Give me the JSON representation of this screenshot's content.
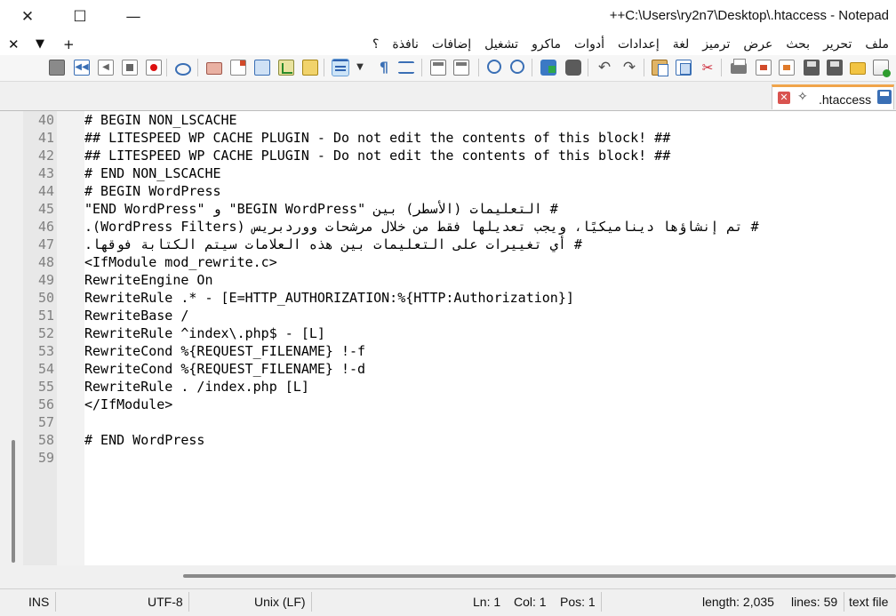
{
  "window": {
    "title": "++C:\\Users\\ry2n7\\Desktop\\.htaccess - Notepad",
    "close_glyph": "✕",
    "maximize_glyph": "☐",
    "minimize_glyph": "—"
  },
  "menubar": {
    "close_glyph": "✕",
    "dropdown_glyph": "▼",
    "add_glyph": "+",
    "items": [
      "ملف",
      "تحرير",
      "بحث",
      "عرض",
      "ترميز",
      "لغة",
      "إعدادات",
      "أدوات",
      "ماكرو",
      "تشغيل",
      "إضافات",
      "نافذة",
      "؟"
    ]
  },
  "tab": {
    "label": ".htaccess"
  },
  "editor": {
    "lines": [
      {
        "n": "40",
        "text": "# BEGIN NON_LSCACHE"
      },
      {
        "n": "41",
        "text": "## LITESPEED WP CACHE PLUGIN - Do not edit the contents of this block! ##"
      },
      {
        "n": "42",
        "text": "## LITESPEED WP CACHE PLUGIN - Do not edit the contents of this block! ##"
      },
      {
        "n": "43",
        "text": "# END NON_LSCACHE"
      },
      {
        "n": "44",
        "text": "# BEGIN WordPress"
      },
      {
        "n": "45",
        "text": "# التعليمات (الأسطر) بين \"BEGIN WordPress\" و \"END WordPress\""
      },
      {
        "n": "46",
        "text": "# تم إنشاؤها ديناميكيًا، ويجب تعديلها فقط من خلال مرشحات ووردبريس (WordPress Filters)."
      },
      {
        "n": "47",
        "text": "# أي تغييرات على التعليمات بين هذه العلامات سيتم الكتابة فوقها."
      },
      {
        "n": "48",
        "text": "<IfModule mod_rewrite.c>"
      },
      {
        "n": "49",
        "text": "RewriteEngine On"
      },
      {
        "n": "50",
        "text": "RewriteRule .* - [E=HTTP_AUTHORIZATION:%{HTTP:Authorization}]"
      },
      {
        "n": "51",
        "text": "RewriteBase /"
      },
      {
        "n": "52",
        "text": "RewriteRule ^index\\.php$ - [L]"
      },
      {
        "n": "53",
        "text": "RewriteCond %{REQUEST_FILENAME} !-f"
      },
      {
        "n": "54",
        "text": "RewriteCond %{REQUEST_FILENAME} !-d"
      },
      {
        "n": "55",
        "text": "RewriteRule . /index.php [L]"
      },
      {
        "n": "56",
        "text": "</IfModule>"
      },
      {
        "n": "57",
        "text": ""
      },
      {
        "n": "58",
        "text": "# END WordPress"
      },
      {
        "n": "59",
        "text": ""
      }
    ]
  },
  "statusbar": {
    "mode": "INS",
    "encoding": "UTF-8",
    "eol": "Unix (LF)",
    "ln": "Ln: 1",
    "col": "Col: 1",
    "pos": "Pos: 1",
    "length": "length: 2,035",
    "lines": "lines: 59",
    "type": "text file"
  },
  "colors": {
    "tab_accent": "#f0a44a",
    "selected_tool": "#cde4f7"
  },
  "icons": [
    "new-file-icon",
    "open-file-icon",
    "save-icon",
    "save-all-icon",
    "close-icon",
    "close-all-icon",
    "print-icon",
    "cut-icon",
    "copy-icon",
    "paste-icon",
    "undo-icon",
    "redo-icon",
    "find-icon",
    "replace-icon",
    "zoom-in-icon",
    "zoom-out-icon",
    "sync-icon",
    "wrap-icon",
    "indent-guide-icon",
    "show-all-chars-icon",
    "doc-map-icon",
    "monitor-icon",
    "record-macro-icon",
    "stop-macro-icon",
    "play-macro-icon",
    "run-macro-icon",
    "save-macro-icon"
  ]
}
